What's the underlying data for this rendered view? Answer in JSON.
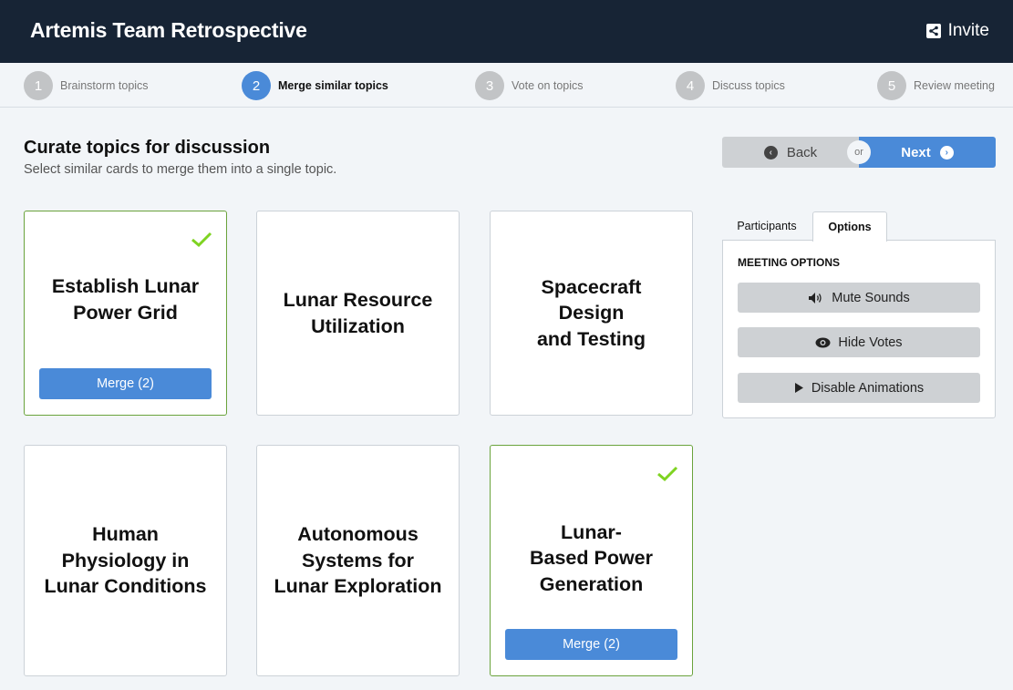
{
  "header": {
    "title": "Artemis Team Retrospective",
    "invite_label": "Invite",
    "invite_icon": "share-icon"
  },
  "steps": [
    {
      "number": "1",
      "label": "Brainstorm topics",
      "active": false
    },
    {
      "number": "2",
      "label": "Merge similar topics",
      "active": true
    },
    {
      "number": "3",
      "label": "Vote on topics",
      "active": false
    },
    {
      "number": "4",
      "label": "Discuss topics",
      "active": false
    },
    {
      "number": "5",
      "label": "Review meeting",
      "active": false
    }
  ],
  "main": {
    "heading": "Curate topics for discussion",
    "subheading": "Select similar cards to merge them into a single topic."
  },
  "nav": {
    "back_label": "Back",
    "or_label": "or",
    "next_label": "Next",
    "back_icon": "chevron-left-circle-icon",
    "next_icon": "chevron-right-circle-icon"
  },
  "cards": [
    {
      "title": "Establish Lunar\nPower Grid",
      "selected": true,
      "merge_label": "Merge (2)"
    },
    {
      "title": "Lunar Resource\nUtilization",
      "selected": false
    },
    {
      "title": "Spacecraft\nDesign\nand Testing",
      "selected": false
    },
    {
      "title": "Human\nPhysiology in\nLunar Conditions",
      "selected": false
    },
    {
      "title": "Autonomous\nSystems for\nLunar Exploration",
      "selected": false
    },
    {
      "title": "Lunar-\nBased Power\nGeneration",
      "selected": true,
      "merge_label": "Merge (2)"
    }
  ],
  "sidebar": {
    "tabs": [
      {
        "label": "Participants",
        "active": false
      },
      {
        "label": "Options",
        "active": true
      }
    ],
    "panel_title": "MEETING OPTIONS",
    "options": [
      {
        "label": "Mute Sounds",
        "icon": "volume-icon"
      },
      {
        "label": "Hide Votes",
        "icon": "eye-icon"
      },
      {
        "label": "Disable Animations",
        "icon": "play-icon"
      }
    ]
  },
  "colors": {
    "topbar": "#172435",
    "accent": "#4a8ad8",
    "selected_border": "#6aa33c",
    "check": "#7ed321",
    "neutral_button": "#ced1d4",
    "background": "#f2f5f8"
  }
}
